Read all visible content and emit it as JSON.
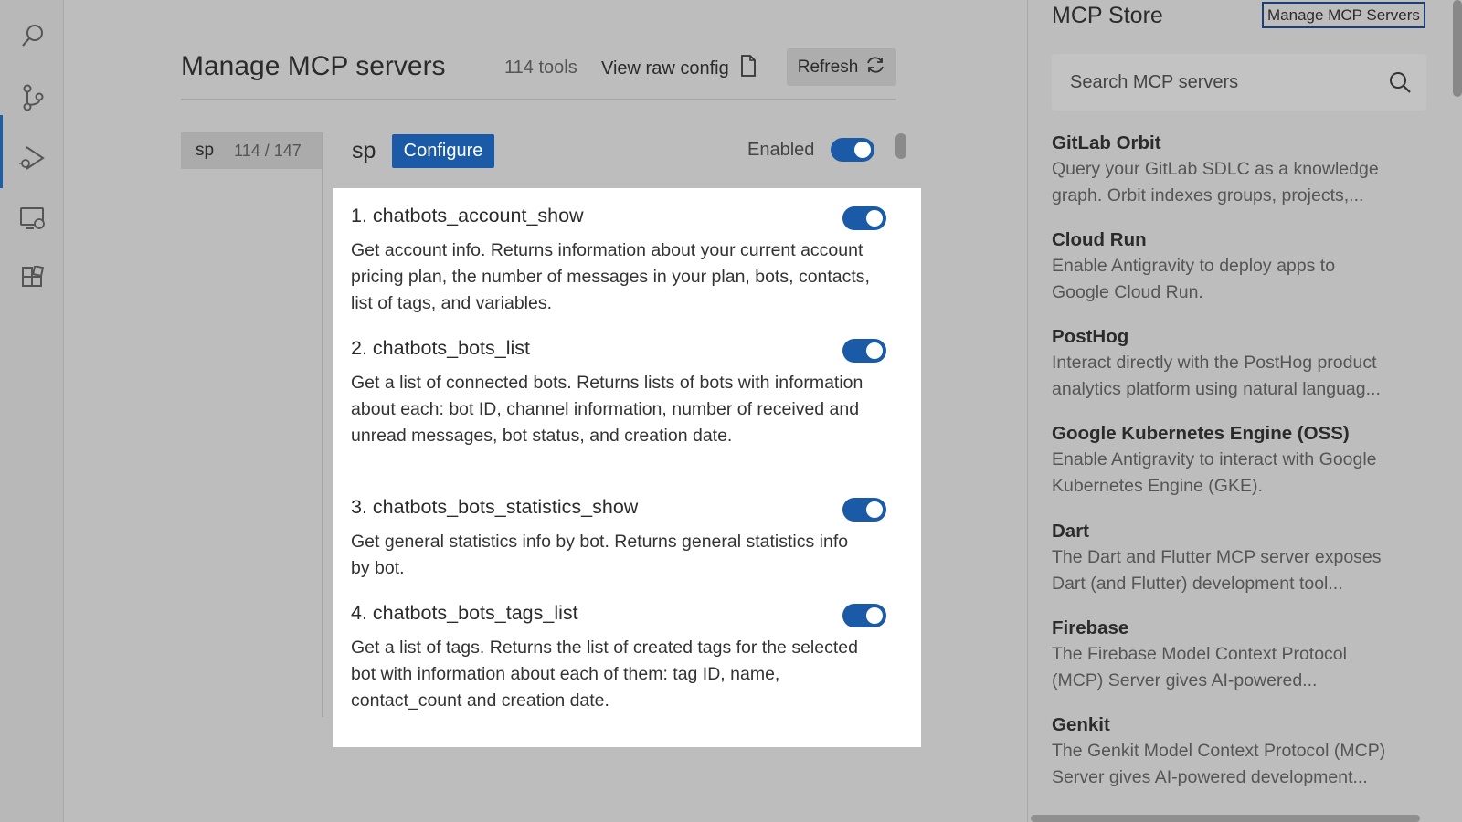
{
  "activity": {
    "icons": [
      "search-icon",
      "source-control-icon",
      "run-debug-icon",
      "remote-explorer-icon",
      "extensions-icon"
    ]
  },
  "header": {
    "title": "Manage MCP servers",
    "tools_count": "114 tools",
    "raw_config": "View raw config",
    "refresh": "Refresh"
  },
  "server_list": {
    "items": [
      {
        "name": "sp",
        "count": "114 / 147"
      }
    ]
  },
  "detail": {
    "server_name": "sp",
    "configure": "Configure",
    "enabled_label": "Enabled",
    "enabled": true
  },
  "tools": [
    {
      "title": "1. chatbots_account_show",
      "desc": "Get account info. Returns information about your current account pricing plan, the number of messages in your plan, bots, contacts, list of tags, and variables.",
      "enabled": true
    },
    {
      "title": "2. chatbots_bots_list",
      "desc": "Get a list of connected bots. Returns lists of bots with information about each: bot ID, channel information, number of received and unread messages, bot status, and creation date.",
      "enabled": true
    },
    {
      "title": "3. chatbots_bots_statistics_show",
      "desc": "Get general statistics info by bot. Returns general statistics info by bot.",
      "enabled": true
    },
    {
      "title": "4. chatbots_bots_tags_list",
      "desc": "Get a list of tags. Returns the list of created tags for the selected bot with information about each of them: tag ID, name, contact_count and creation date.",
      "enabled": true
    }
  ],
  "store": {
    "title": "MCP Store",
    "manage_button": "Manage MCP Servers",
    "search_placeholder": "Search MCP servers",
    "items": [
      {
        "name": "GitLab Orbit",
        "desc1": "Query your GitLab SDLC as a knowledge",
        "desc2": "graph. Orbit indexes groups, projects,..."
      },
      {
        "name": "Cloud Run",
        "desc1": "Enable Antigravity to deploy apps to",
        "desc2": "Google Cloud Run."
      },
      {
        "name": "PostHog",
        "desc1": "Interact directly with the PostHog product",
        "desc2": "analytics platform using natural languag..."
      },
      {
        "name": "Google Kubernetes Engine (OSS)",
        "desc1": "Enable Antigravity to interact with Google",
        "desc2": "Kubernetes Engine (GKE)."
      },
      {
        "name": "Dart",
        "desc1": "The Dart and Flutter MCP server exposes",
        "desc2": "Dart (and Flutter) development tool..."
      },
      {
        "name": "Firebase",
        "desc1": "The Firebase Model Context Protocol",
        "desc2": "(MCP) Server gives AI-powered..."
      },
      {
        "name": "Genkit",
        "desc1": "The Genkit Model Context Protocol (MCP)",
        "desc2": "Server gives AI-powered development..."
      }
    ]
  },
  "colors": {
    "accent": "#1b5aa6",
    "background": "#bdbdbd",
    "panel": "#ffffff"
  }
}
